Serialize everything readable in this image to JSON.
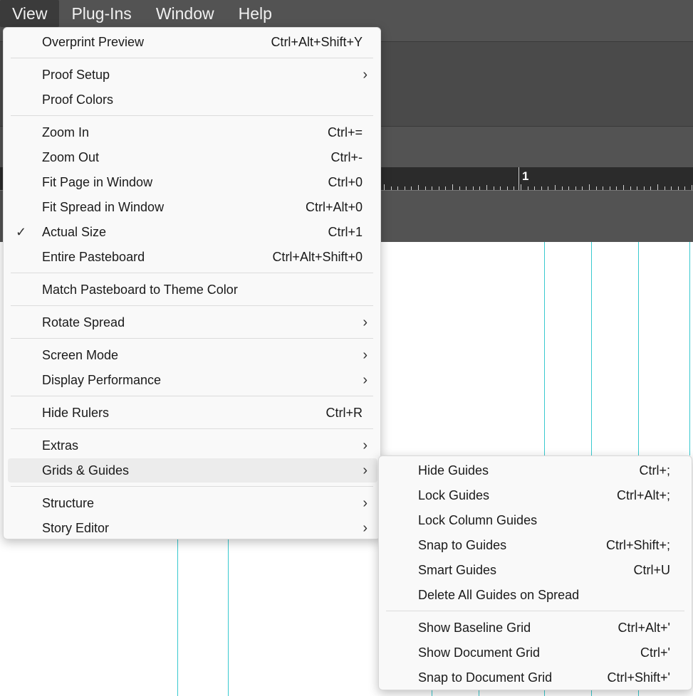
{
  "menubar": {
    "items": [
      "View",
      "Plug-Ins",
      "Window",
      "Help"
    ]
  },
  "ruler": {
    "label": "1"
  },
  "view_menu": {
    "items": [
      {
        "label": "Overprint Preview",
        "shortcut": "Ctrl+Alt+Shift+Y"
      },
      {
        "label": "Proof Setup",
        "submenu": true
      },
      {
        "label": "Proof Colors"
      },
      {
        "label": "Zoom In",
        "shortcut": "Ctrl+="
      },
      {
        "label": "Zoom Out",
        "shortcut": "Ctrl+-"
      },
      {
        "label": "Fit Page in Window",
        "shortcut": "Ctrl+0"
      },
      {
        "label": "Fit Spread in Window",
        "shortcut": "Ctrl+Alt+0"
      },
      {
        "label": "Actual Size",
        "shortcut": "Ctrl+1",
        "checked": true
      },
      {
        "label": "Entire Pasteboard",
        "shortcut": "Ctrl+Alt+Shift+0"
      },
      {
        "label": "Match Pasteboard to Theme Color"
      },
      {
        "label": "Rotate Spread",
        "submenu": true
      },
      {
        "label": "Screen Mode",
        "submenu": true
      },
      {
        "label": "Display Performance",
        "submenu": true
      },
      {
        "label": "Hide Rulers",
        "shortcut": "Ctrl+R"
      },
      {
        "label": "Extras",
        "submenu": true
      },
      {
        "label": "Grids & Guides",
        "submenu": true,
        "highlighted": true
      },
      {
        "label": "Structure",
        "submenu": true
      },
      {
        "label": "Story Editor",
        "submenu": true
      }
    ],
    "submenu_arrow": "›",
    "check_mark": "✓"
  },
  "grids_guides_menu": {
    "items": [
      {
        "label": "Hide Guides",
        "shortcut": "Ctrl+;"
      },
      {
        "label": "Lock Guides",
        "shortcut": "Ctrl+Alt+;"
      },
      {
        "label": "Lock Column Guides"
      },
      {
        "label": "Snap to Guides",
        "shortcut": "Ctrl+Shift+;"
      },
      {
        "label": "Smart Guides",
        "shortcut": "Ctrl+U"
      },
      {
        "label": "Delete All Guides on Spread"
      },
      {
        "label": "Show Baseline Grid",
        "shortcut": "Ctrl+Alt+'"
      },
      {
        "label": "Show Document Grid",
        "shortcut": "Ctrl+'"
      },
      {
        "label": "Snap to Document Grid",
        "shortcut": "Ctrl+Shift+'"
      }
    ]
  },
  "colors": {
    "guide": "#39c9cf",
    "menubar": "#535353",
    "menu_bg": "#f9f9f9",
    "highlight": "#ececec"
  }
}
